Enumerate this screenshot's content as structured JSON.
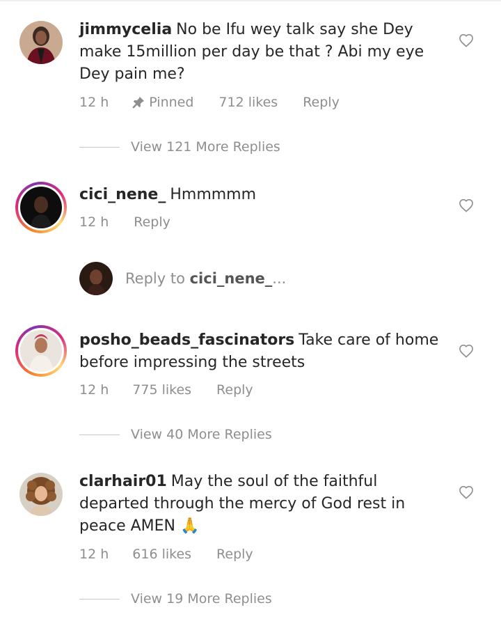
{
  "comments": [
    {
      "username": "jimmycelia",
      "text": "No be Ifu wey talk say she Dey make 15million per day be that ? Abi my eye Dey pain me?",
      "time": "12 h",
      "pinned_label": "Pinned",
      "likes": "712 likes",
      "reply_label": "Reply",
      "view_replies": "View 121 More Replies"
    },
    {
      "username": "cici_nene_",
      "text": "Hmmmmm",
      "time": "12 h",
      "reply_label": "Reply",
      "reply_to": {
        "prefix": "Reply to",
        "username": "cici_nene_",
        "ellipsis": "..."
      }
    },
    {
      "username": "posho_beads_fascinators",
      "text": "Take care of home before impressing the streets",
      "time": "12 h",
      "likes": "775 likes",
      "reply_label": "Reply",
      "view_replies": "View 40 More Replies"
    },
    {
      "username": "clarhair01",
      "text": "May the soul of the faithful departed through the mercy of God rest in peace AMEN 🙏",
      "time": "12 h",
      "likes": "616 likes",
      "reply_label": "Reply",
      "view_replies": "View 19 More Replies"
    }
  ],
  "colors": {
    "text": "#262626",
    "secondary": "#8e8e8e",
    "story_ring": "#dd2a7b"
  },
  "icons": [
    "heart-icon",
    "pin-icon",
    "praying-hands-emoji"
  ]
}
